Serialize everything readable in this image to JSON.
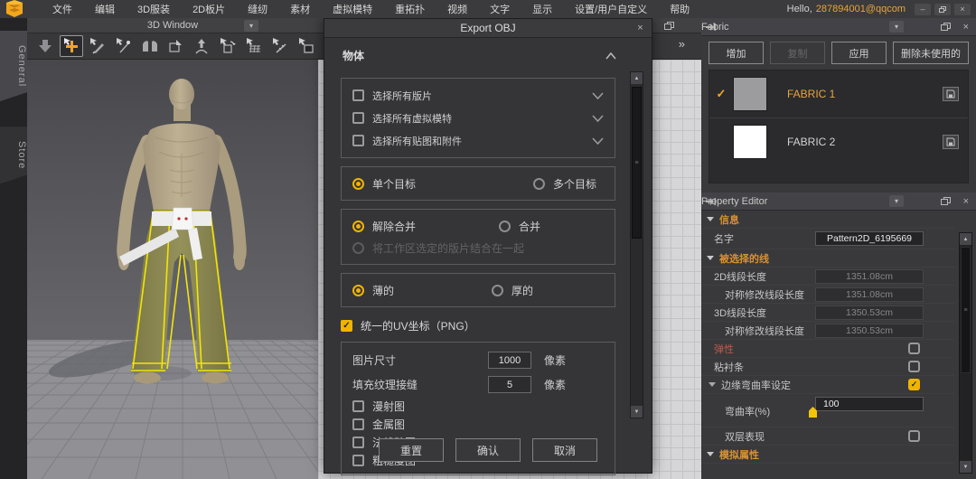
{
  "accent": {
    "orange": "#e8a43c",
    "yellow": "#f0b400",
    "red_label": "#c05a4a"
  },
  "icons": {
    "dropdown": "▾",
    "close": "×",
    "minimize": "–",
    "scroll_up": "▲",
    "scroll_down": "▼",
    "check": "✓",
    "chevron_double": "»",
    "pin": "→",
    "grip": "≡"
  },
  "menubar": {
    "items": [
      "文件",
      "编辑",
      "3D服装",
      "2D板片",
      "缝纫",
      "素材",
      "虚拟模特",
      "重拓扑",
      "视频",
      "文字",
      "显示",
      "设置/用户自定义",
      "帮助"
    ],
    "greeting": "Hello,",
    "account": "287894001@qqcom"
  },
  "sidebar": {
    "general": "General",
    "store": "Store"
  },
  "viewport": {
    "title": "3D Window"
  },
  "dialog": {
    "title": "Export OBJ",
    "object_section": "物体",
    "select_all_rows": [
      "选择所有版片",
      "选择所有虚拟模特",
      "选择所有贴图和附件"
    ],
    "target": {
      "single": "单个目标",
      "multiple": "多个目标"
    },
    "weld": {
      "unweld": "解除合并",
      "weld": "合并",
      "combine": "将工作区选定的版片结合在一起"
    },
    "thickness": {
      "thin": "薄的",
      "thick": "厚的"
    },
    "uv_label": "统一的UV坐标（PNG）",
    "image_size_label": "图片尺寸",
    "image_size_value": "1000",
    "image_size_unit": "像素",
    "seam_label": "填充纹理接缝",
    "seam_value": "5",
    "seam_unit": "像素",
    "maps": [
      "漫射图",
      "金属图",
      "法线贴图",
      "粗糙度图"
    ],
    "reset": "重置",
    "confirm": "确认",
    "cancel": "取消"
  },
  "fabric": {
    "title": "Fabric",
    "add": "增加",
    "copy": "复制",
    "apply": "应用",
    "delete_unused": "删除未使用的",
    "items": [
      {
        "name": "FABRIC 1"
      },
      {
        "name": "FABRIC 2"
      }
    ]
  },
  "props": {
    "title": "Property Editor",
    "info": "信息",
    "name_label": "名字",
    "name_value": "Pattern2D_6195669",
    "selected_line": "被选择的线",
    "len_rows": [
      {
        "label": "2D线段长度",
        "value": "1351.08cm"
      },
      {
        "label": "对称修改线段长度",
        "value": "1351.08cm"
      },
      {
        "label": "3D线段长度",
        "value": "1350.53cm"
      },
      {
        "label": "对称修改线段长度",
        "value": "1350.53cm"
      }
    ],
    "elastic": "弹性",
    "bonding": "粘衬条",
    "curvature_section": "边缘弯曲率设定",
    "curvature_label": "弯曲率(%)",
    "curvature_value": "100",
    "double_layer": "双层表现",
    "simulation": "模拟属性"
  }
}
